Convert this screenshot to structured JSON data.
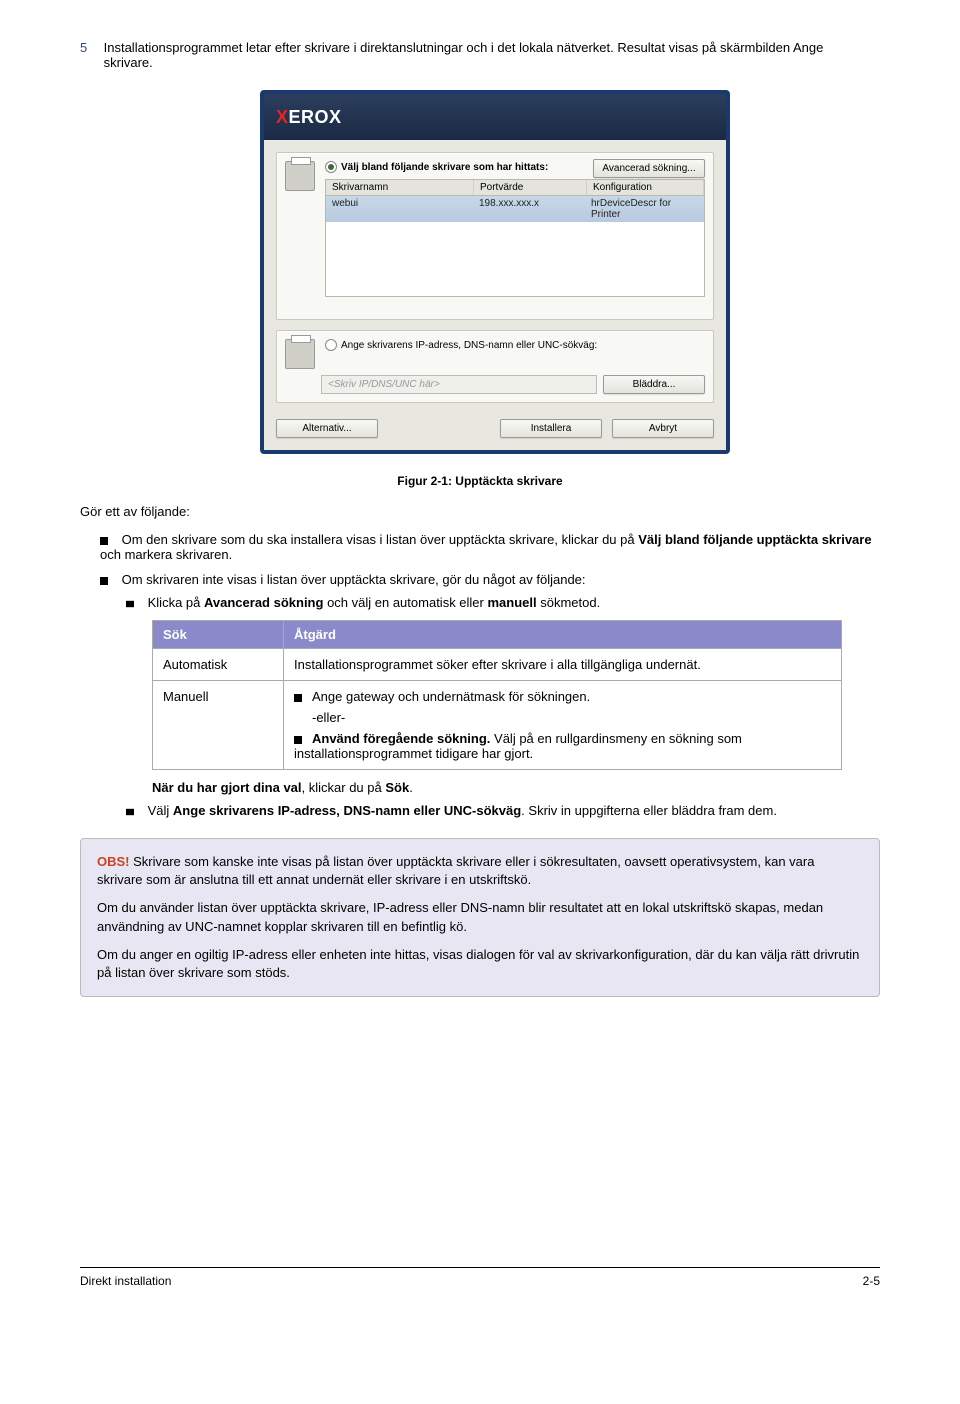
{
  "step": {
    "number": "5",
    "text_before": "Installationsprogrammet letar efter skrivare i direktanslutningar och i det lokala nätverket. Resultat visas på skärmbilden Ange skrivare."
  },
  "dialog": {
    "logo_text": "XEROX",
    "radio1_label": "Välj bland följande skrivare som har hittats:",
    "advanced_btn": "Avancerad sökning...",
    "col1": "Skrivarnamn",
    "col2": "Portvärde",
    "col3": "Konfiguration",
    "row": {
      "c1": "webui",
      "c2": "198.xxx.xxx.x",
      "c3": "hrDeviceDescr for Printer"
    },
    "radio2_label": "Ange skrivarens IP-adress, DNS-namn eller UNC-sökväg:",
    "ip_placeholder": "<Skriv IP/DNS/UNC här>",
    "browse_btn": "Bläddra...",
    "options_btn": "Alternativ...",
    "install_btn": "Installera",
    "cancel_btn": "Avbryt"
  },
  "fig_caption": "Figur 2-1:  Upptäckta skrivare",
  "body": {
    "gor": "Gör ett av följande:",
    "b1a": "Om den skrivare som du ska installera visas i listan över upptäckta skrivare, klickar du på ",
    "b1b": "Välj bland följande upptäckta skrivare",
    "b1c": " och markera skrivaren.",
    "b2": "Om skrivaren inte visas i listan över upptäckta skrivare, gör du något av följande:",
    "sub1a": "Klicka på ",
    "sub1b": "Avancerad sökning",
    "sub1c": " och välj en automatisk eller ",
    "sub1d": "manuell",
    "sub1e": " sökmetod.",
    "table": {
      "h1": "Sök",
      "h2": "Åtgärd",
      "r1c1": "Automatisk",
      "r1c2": "Installationsprogrammet söker efter skrivare i alla tillgängliga undernät.",
      "r2c1": "Manuell",
      "r2c2_item1": "Ange gateway och undernätmask för sökningen.",
      "r2c2_or": "-eller-",
      "r2c2_item2a": "Använd föregående sökning.",
      "r2c2_item2b": " Välj på en rullgardinsmeny en sökning som installationsprogrammet tidigare har gjort."
    },
    "after_table_a": "När du har gjort dina val",
    "after_table_b": ", klickar du på ",
    "after_table_c": "Sök",
    "after_table_d": ".",
    "sub2a": "Välj ",
    "sub2b": "Ange skrivarens IP-adress, DNS-namn eller UNC-sökväg",
    "sub2c": ". Skriv in uppgifterna eller bläddra fram dem."
  },
  "obs": {
    "label": "OBS!",
    "p1": " Skrivare som kanske inte visas på listan över upptäckta skrivare eller i sökresultaten, oavsett operativsystem, kan vara skrivare som är anslutna till ett annat undernät eller skrivare i en utskriftskö.",
    "p2": "Om du använder listan över upptäckta skrivare, IP-adress eller DNS-namn blir resultatet att en lokal utskriftskö skapas, medan användning av UNC-namnet kopplar skrivaren till en befintlig kö.",
    "p3": "Om du anger en ogiltig IP-adress eller enheten inte hittas, visas dialogen för val av skrivarkonfiguration, där du kan välja rätt drivrutin på listan över skrivare som stöds."
  },
  "footer": {
    "left": "Direkt installation",
    "right": "2-5"
  }
}
